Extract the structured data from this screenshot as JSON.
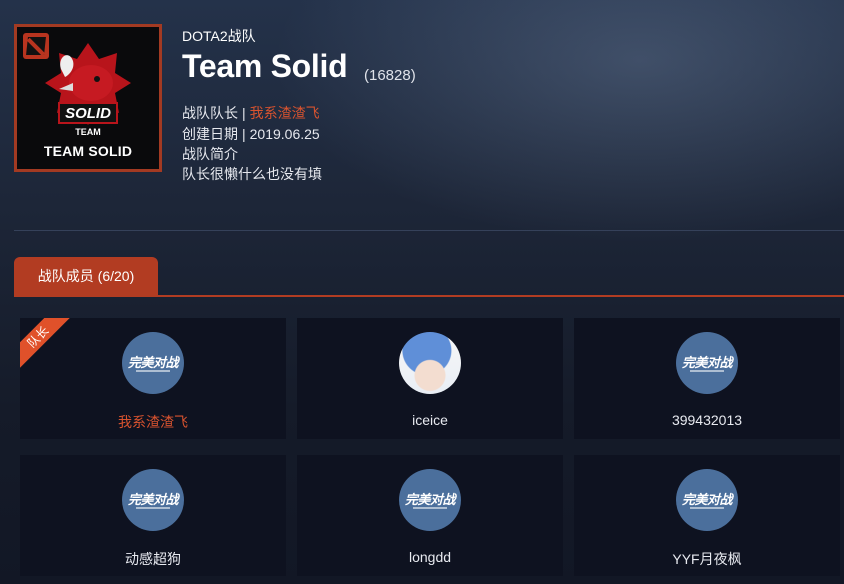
{
  "team": {
    "logo_caption": "TEAM SOLID",
    "logo_text": "SOLID",
    "logo_subtext": "TEAM",
    "game_label": "DOTA2战队",
    "name": "Team Solid",
    "id": "(16828)",
    "captain_label": "战队队长",
    "captain_name": "我系渣渣飞",
    "created_label": "创建日期",
    "created_date": "2019.06.25",
    "intro_label": "战队简介",
    "intro_text": "队长很懒什么也没有填",
    "separator": "|"
  },
  "tab": {
    "label": "战队成员 (6/20)"
  },
  "members": [
    {
      "name": "我系渣渣飞",
      "avatar": "default-logo",
      "avatar_text": "完美对战",
      "is_captain": true,
      "captain_badge": "队长"
    },
    {
      "name": "iceice",
      "avatar": "anime-character"
    },
    {
      "name": "399432013",
      "avatar": "default-logo",
      "avatar_text": "完美对战"
    },
    {
      "name": "动感超狗",
      "avatar": "default-logo",
      "avatar_text": "完美对战"
    },
    {
      "name": "longdd",
      "avatar": "default-logo",
      "avatar_text": "完美对战"
    },
    {
      "name": "YYF月夜枫",
      "avatar": "default-logo",
      "avatar_text": "完美对战"
    }
  ],
  "colors": {
    "accent": "#b23c22",
    "captain_text": "#d8532f",
    "card_bg": "#0e1220",
    "avatar_bg": "#4b6f9c"
  }
}
